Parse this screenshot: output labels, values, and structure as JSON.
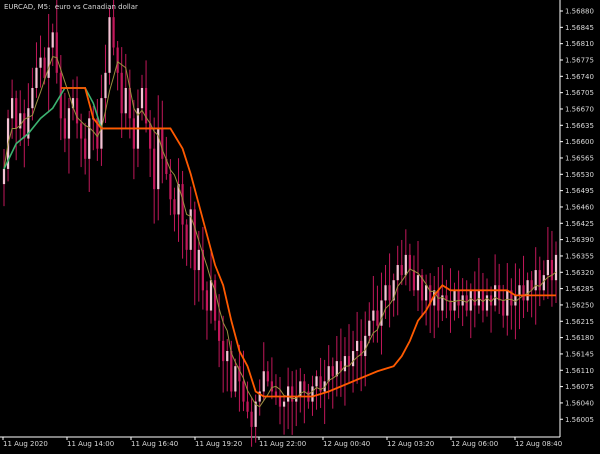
{
  "header": {
    "symbol": "EURCAD,",
    "timeframe": "M5:",
    "description": "euro vs Canadian dollar"
  },
  "chart_data": {
    "type": "candlestick",
    "ylim": [
      1.5603,
      1.5689
    ],
    "y_ticks": [
      "1.56880",
      "1.56845",
      "1.56810",
      "1.56775",
      "1.56740",
      "1.56705",
      "1.56670",
      "1.56635",
      "1.56600",
      "1.56565",
      "1.56530",
      "1.56495",
      "1.56460",
      "1.56425",
      "1.56390",
      "1.56355",
      "1.56320",
      "1.56285",
      "1.56250",
      "1.56215",
      "1.56180",
      "1.56145",
      "1.56110",
      "1.56075",
      "1.56040",
      "1.56005"
    ],
    "x_ticks": [
      "11 Aug 2020",
      "11 Aug 14:00",
      "11 Aug 16:40",
      "11 Aug 19:20",
      "11 Aug 22:00",
      "12 Aug 00:40",
      "12 Aug 03:20",
      "12 Aug 06:00",
      "12 Aug 08:40"
    ],
    "bar_count": 137,
    "colors": {
      "background": "#000000",
      "candle": "#c2185b",
      "candle_light": "#f4c2d4",
      "ma_fast": "#9b8f3f",
      "line_green": "#3cb371",
      "line_orange": "#ff5a00",
      "axis": "#ffffff",
      "text": "#d9d9d9"
    },
    "green_line": [
      [
        0,
        1.5656
      ],
      [
        3,
        1.5661
      ],
      [
        6,
        1.5663
      ],
      [
        9,
        1.5666
      ],
      [
        12,
        1.5668
      ],
      [
        15,
        1.5672
      ],
      [
        18,
        1.5672
      ],
      [
        20,
        1.5672
      ],
      [
        22,
        1.5669
      ],
      [
        24,
        1.5664
      ],
      [
        27,
        1.5664
      ],
      [
        33,
        1.5664
      ],
      [
        40,
        1.5664
      ],
      [
        41,
        1.5664
      ]
    ],
    "orange_line": [
      [
        14,
        1.5672
      ],
      [
        18,
        1.5672
      ],
      [
        20,
        1.5672
      ],
      [
        22,
        1.5666
      ],
      [
        24,
        1.5664
      ],
      [
        30,
        1.5664
      ],
      [
        41,
        1.5664
      ],
      [
        44,
        1.566
      ],
      [
        46,
        1.5655
      ],
      [
        48,
        1.5649
      ],
      [
        50,
        1.5643
      ],
      [
        52,
        1.5637
      ],
      [
        54,
        1.5633
      ],
      [
        56,
        1.5626
      ],
      [
        58,
        1.562
      ],
      [
        60,
        1.5617
      ],
      [
        62,
        1.5612
      ],
      [
        64,
        1.5611
      ],
      [
        66,
        1.5611
      ],
      [
        76,
        1.5611
      ],
      [
        80,
        1.5612
      ],
      [
        86,
        1.5614
      ],
      [
        92,
        1.5616
      ],
      [
        96,
        1.5617
      ],
      [
        98,
        1.5619
      ],
      [
        100,
        1.5622
      ],
      [
        102,
        1.5626
      ],
      [
        104,
        1.5628
      ],
      [
        106,
        1.5631
      ],
      [
        108,
        1.5633
      ],
      [
        110,
        1.5632
      ],
      [
        114,
        1.5632
      ],
      [
        120,
        1.5632
      ],
      [
        124,
        1.5632
      ],
      [
        126,
        1.5631
      ],
      [
        130,
        1.5631
      ],
      [
        133,
        1.5631
      ],
      [
        136,
        1.5631
      ]
    ],
    "close": [
      1.5656,
      1.5666,
      1.567,
      1.5664,
      1.5667,
      1.5662,
      1.5668,
      1.5672,
      1.5676,
      1.5678,
      1.5674,
      1.568,
      1.5683,
      1.5675,
      1.5666,
      1.5662,
      1.5668,
      1.567,
      1.5665,
      1.5662,
      1.5658,
      1.5666,
      1.5666,
      1.566,
      1.567,
      1.5675,
      1.5686,
      1.568,
      1.5675,
      1.5667,
      1.5672,
      1.5666,
      1.566,
      1.5668,
      1.5672,
      1.5665,
      1.566,
      1.5652,
      1.5664,
      1.5658,
      1.5655,
      1.565,
      1.5647,
      1.5653,
      1.5645,
      1.564,
      1.5648,
      1.5636,
      1.564,
      1.5632,
      1.5628,
      1.5634,
      1.5626,
      1.5622,
      1.5618,
      1.562,
      1.5612,
      1.5617,
      1.5614,
      1.561,
      1.5608,
      1.5605,
      1.561,
      1.5612,
      1.5616,
      1.5614,
      1.5612,
      1.5611,
      1.5609,
      1.561,
      1.5613,
      1.561,
      1.5611,
      1.5614,
      1.5612,
      1.561,
      1.5613,
      1.5615,
      1.5612,
      1.5614,
      1.5617,
      1.5615,
      1.5618,
      1.5616,
      1.5619,
      1.5617,
      1.562,
      1.5622,
      1.5619,
      1.5623,
      1.5626,
      1.5628,
      1.5625,
      1.563,
      1.5633,
      1.563,
      1.5634,
      1.5637,
      1.5635,
      1.5639,
      1.5636,
      1.5632,
      1.5635,
      1.563,
      1.5633,
      1.5629,
      1.5632,
      1.5628,
      1.5631,
      1.563,
      1.5628,
      1.5632,
      1.5629,
      1.5631,
      1.5628,
      1.5632,
      1.5629,
      1.5632,
      1.5628,
      1.5631,
      1.5629,
      1.5633,
      1.563,
      1.5627,
      1.5632,
      1.5629,
      1.5631,
      1.5633,
      1.563,
      1.5634,
      1.5632,
      1.5636,
      1.5632,
      1.5635,
      1.5638,
      1.5634,
      1.5639
    ]
  }
}
